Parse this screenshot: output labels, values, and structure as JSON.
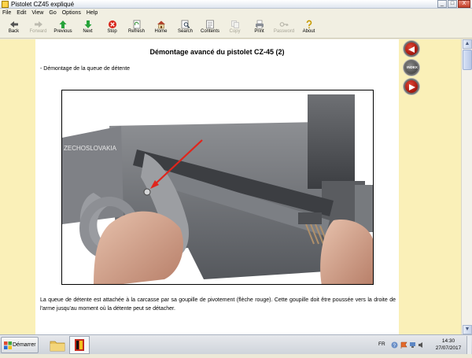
{
  "window": {
    "title": "Pistolet CZ45 expliqué",
    "buttons": {
      "minimize": "_",
      "maximize": "□",
      "close": "X"
    }
  },
  "menu": [
    "File",
    "Edit",
    "View",
    "Go",
    "Options",
    "Help"
  ],
  "toolbar": [
    {
      "label": "Back",
      "icon": "back-arrow-icon",
      "enabled": true
    },
    {
      "label": "Forward",
      "icon": "forward-arrow-icon",
      "enabled": false
    },
    {
      "label": "Previous",
      "icon": "previous-arrow-icon",
      "enabled": true
    },
    {
      "label": "Next",
      "icon": "next-arrow-icon",
      "enabled": true
    },
    {
      "label": "Stop",
      "icon": "stop-icon",
      "enabled": true
    },
    {
      "label": "Refresh",
      "icon": "refresh-icon",
      "enabled": true
    },
    {
      "label": "Home",
      "icon": "home-icon",
      "enabled": true
    },
    {
      "label": "Search",
      "icon": "search-icon",
      "enabled": true
    },
    {
      "label": "Contents",
      "icon": "contents-icon",
      "enabled": true
    },
    {
      "label": "Copy",
      "icon": "copy-icon",
      "enabled": false
    },
    {
      "label": "Print",
      "icon": "print-icon",
      "enabled": true
    },
    {
      "label": "Password",
      "icon": "password-key-icon",
      "enabled": false
    },
    {
      "label": "About",
      "icon": "about-icon",
      "enabled": true
    }
  ],
  "page": {
    "title": "Démontage avancé du pistolet CZ-45 (2)",
    "section": "- Démontage de la queue de détente",
    "photo_engraving": "ZECHOSLOVAKIA",
    "caption": "La queue de détente est attachée à la carcasse par sa goupille de pivotement (flèche rouge). Cette goupille doit être poussée vers la droite de l'arme jusqu'au moment où la détente peut se détacher."
  },
  "nav": {
    "index_label": "INDEX"
  },
  "taskbar": {
    "start_label": "Démarrer",
    "language": "FR",
    "time": "14:30",
    "date": "27/07/2017"
  },
  "colors": {
    "side_panes": "#faf0b8",
    "nav_buttons": "#c0231a"
  }
}
